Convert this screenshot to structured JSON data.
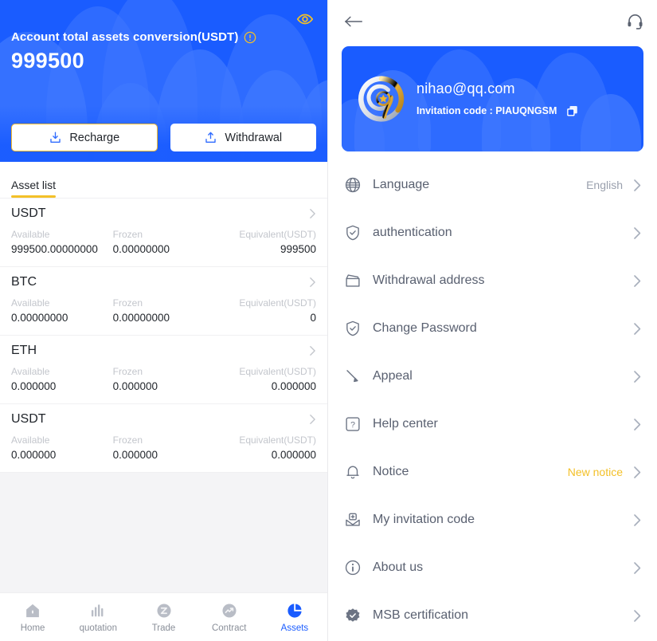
{
  "assets_panel": {
    "hero": {
      "title": "Account total assets conversion(USDT)",
      "info_icon": "info-circle-icon",
      "amount": "999500",
      "eye_icon": "eye-icon",
      "recharge_label": "Recharge",
      "recharge_icon": "download-tray-icon",
      "withdrawal_label": "Withdrawal",
      "withdrawal_icon": "upload-tray-icon",
      "accent_color": "#f3b72c",
      "bg_color": "#1a5cff"
    },
    "tabs": [
      {
        "label": "Asset list",
        "active": true
      }
    ],
    "columns": {
      "available": "Available",
      "frozen": "Frozen",
      "equivalent": "Equivalent(USDT)"
    },
    "rows": [
      {
        "symbol": "USDT",
        "available": "999500.00000000",
        "frozen": "0.00000000",
        "equivalent": "999500"
      },
      {
        "symbol": "BTC",
        "available": "0.00000000",
        "frozen": "0.00000000",
        "equivalent": "0"
      },
      {
        "symbol": "ETH",
        "available": "0.000000",
        "frozen": "0.000000",
        "equivalent": "0.000000"
      },
      {
        "symbol": "USDT",
        "available": "0.000000",
        "frozen": "0.000000",
        "equivalent": "0.000000"
      }
    ],
    "tabbar": [
      {
        "label": "Home",
        "icon": "home-icon",
        "active": false
      },
      {
        "label": "quotation",
        "icon": "bar-chart-icon",
        "active": false
      },
      {
        "label": "Trade",
        "icon": "trade-circle-icon",
        "active": false
      },
      {
        "label": "Contract",
        "icon": "contract-trend-icon",
        "active": false
      },
      {
        "label": "Assets",
        "icon": "pie-chart-icon",
        "active": true
      }
    ],
    "active_color": "#1a5cff"
  },
  "profile_panel": {
    "topbar": {
      "back_icon": "back-arrow-icon",
      "support_icon": "headset-icon"
    },
    "card": {
      "avatar_icon": "swirl-star-avatar-icon",
      "email": "nihao@qq.com",
      "invitation_label": "Invitation code : PIAUQNGSM",
      "copy_icon": "copy-icon"
    },
    "menu": [
      {
        "label": "Language",
        "icon": "globe-icon",
        "value": "English",
        "highlight": false
      },
      {
        "label": "authentication",
        "icon": "shield-check-icon",
        "value": "",
        "highlight": false
      },
      {
        "label": "Withdrawal address",
        "icon": "wallet-icon",
        "value": "",
        "highlight": false
      },
      {
        "label": "Change Password",
        "icon": "shield-check-icon",
        "value": "",
        "highlight": false
      },
      {
        "label": "Appeal",
        "icon": "pen-icon",
        "value": "",
        "highlight": false
      },
      {
        "label": "Help center",
        "icon": "question-box-icon",
        "value": "",
        "highlight": false
      },
      {
        "label": "Notice",
        "icon": "bell-icon",
        "value": "New notice",
        "highlight": true
      },
      {
        "label": "My invitation code",
        "icon": "envelope-plus-icon",
        "value": "",
        "highlight": false
      },
      {
        "label": "About us",
        "icon": "info-circle-icon",
        "value": "",
        "highlight": false
      },
      {
        "label": "MSB certification",
        "icon": "badge-check-icon",
        "value": "",
        "highlight": false
      }
    ],
    "highlight_color": "#f3c028"
  }
}
